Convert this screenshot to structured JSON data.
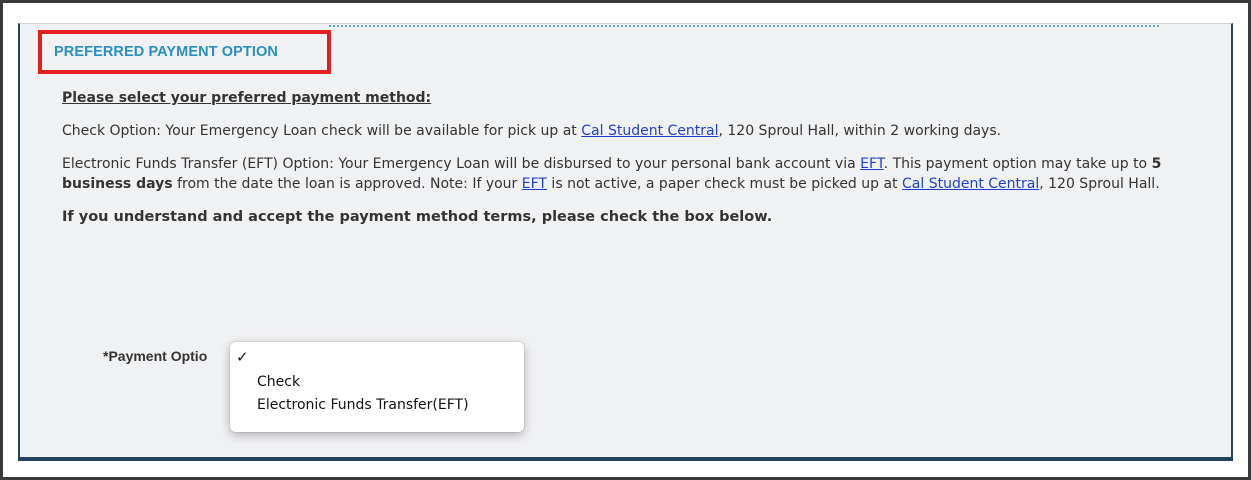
{
  "section": {
    "title": "PREFERRED PAYMENT OPTION"
  },
  "content": {
    "lead": "Please select your preferred payment method:",
    "check_option": {
      "before": "Check Option: Your Emergency Loan check will be available for pick up at ",
      "link": "Cal Student Central",
      "after": ", 120 Sproul Hall, within 2 working days."
    },
    "eft_option": {
      "text1": "Electronic Funds Transfer (EFT) Option: Your Emergency Loan  will be disbursed to your personal bank account via ",
      "link1": "EFT",
      "text2": ". This payment option may take up to ",
      "bold": "5 business days",
      "text3": " from the date the loan is approved. Note: If your ",
      "link2": "EFT",
      "text4": " is not active, a paper check must be picked up at ",
      "link3": "Cal Student Central",
      "text5": ", 120 Sproul Hall."
    },
    "accept_text": "If you understand and accept the payment method terms, please check the box below."
  },
  "payment_field": {
    "label": "*Payment Optio",
    "selected_mark": "✓",
    "options": [
      "Check",
      "Electronic Funds Transfer(EFT)"
    ]
  },
  "colors": {
    "title": "#2a8fbf",
    "highlight_box": "#e11f1f",
    "link": "#1f3fd0",
    "panel_border": "#24425e"
  }
}
